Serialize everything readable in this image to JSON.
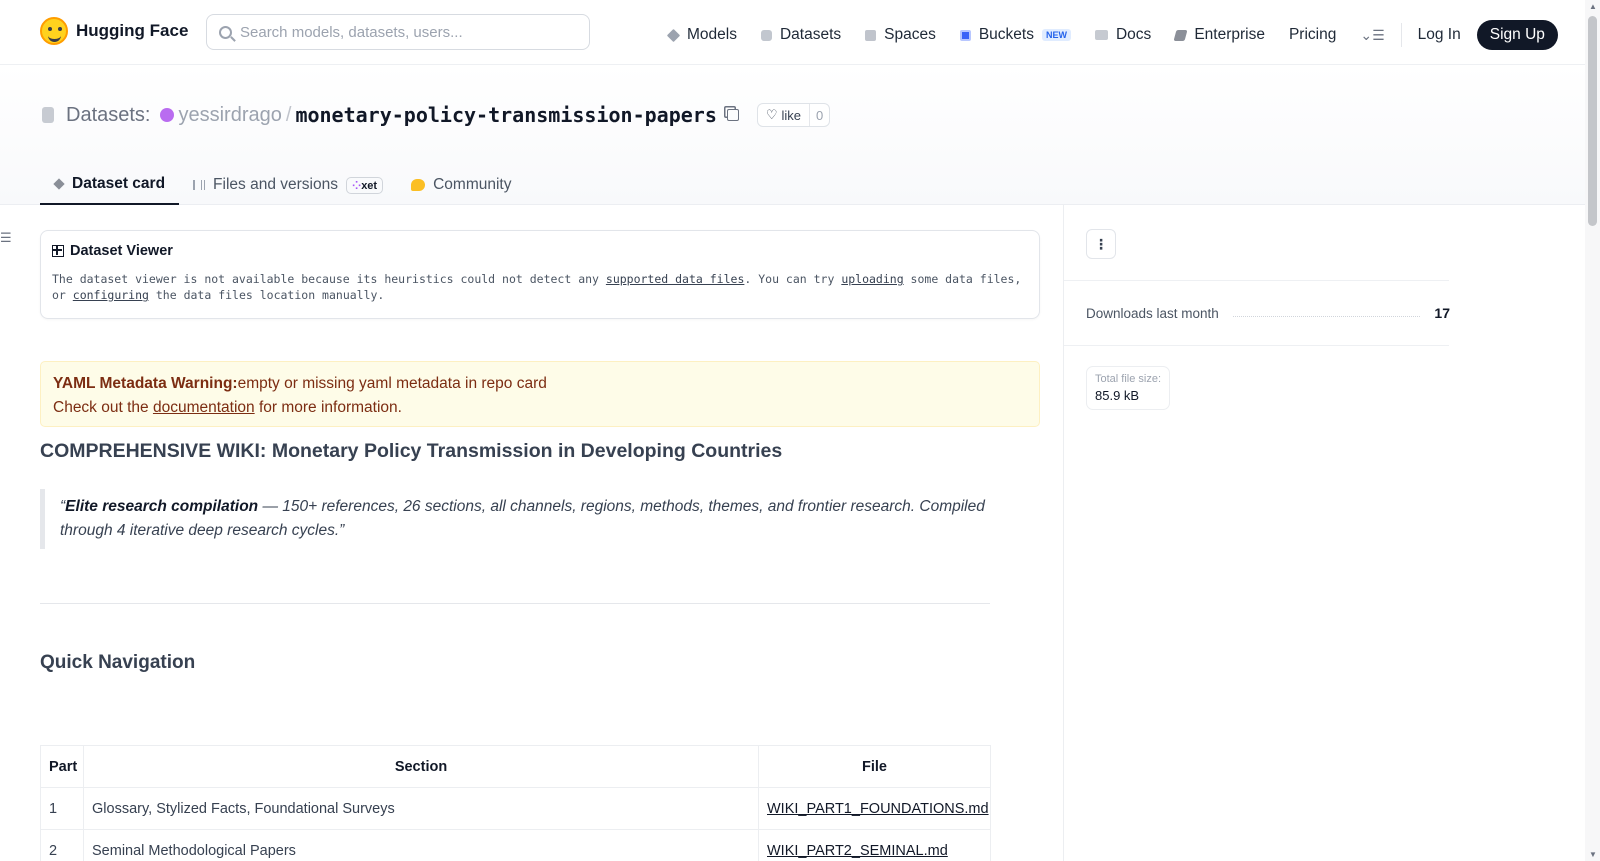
{
  "nav": {
    "brand": "Hugging Face",
    "search_placeholder": "Search models, datasets, users...",
    "links": [
      {
        "label": "Models",
        "icon": "cube-icon"
      },
      {
        "label": "Datasets",
        "icon": "database-icon"
      },
      {
        "label": "Spaces",
        "icon": "grid-icon"
      },
      {
        "label": "Buckets",
        "icon": "bucket-icon",
        "badge": "NEW"
      },
      {
        "label": "Docs",
        "icon": "book-icon"
      },
      {
        "label": "Enterprise",
        "icon": "enterprise-icon"
      },
      {
        "label": "Pricing"
      }
    ],
    "login": "Log In",
    "signup": "Sign Up"
  },
  "repo": {
    "type_label": "Datasets:",
    "owner": "yessirdrago",
    "separator": "/",
    "name": "monetary-policy-transmission-papers",
    "like_label": "like",
    "like_count": "0"
  },
  "tabs": [
    {
      "label": "Dataset card",
      "active": true
    },
    {
      "label": "Files and versions",
      "badge": "xet"
    },
    {
      "label": "Community"
    }
  ],
  "viewer": {
    "title": "Dataset Viewer",
    "text_1": "The dataset viewer is not available because its heuristics could not detect any ",
    "link_1": "supported data files",
    "text_2": ". You can try ",
    "link_2": "uploading",
    "text_3": " some data files, or ",
    "link_3": "configuring",
    "text_4": " the data files location manually."
  },
  "warning": {
    "bold": "YAML Metadata Warning:",
    "message": "empty or missing yaml metadata in repo card",
    "line2_pre": "Check out the ",
    "line2_link": "documentation",
    "line2_post": " for more information."
  },
  "card": {
    "title": "COMPREHENSIVE WIKI: Monetary Policy Transmission in Developing Countries",
    "quote_open": "“",
    "quote_bold": "Elite research compilation",
    "quote_rest": " — 150+ references, 26 sections, all channels, regions, methods, themes, and frontier research. Compiled through 4 iterative deep research cycles.”",
    "quick_nav": "Quick Navigation",
    "table_headers": [
      "Part",
      "Section",
      "File"
    ],
    "table_rows": [
      {
        "part": "1",
        "section": "Glossary, Stylized Facts, Foundational Surveys",
        "file": "WIKI_PART1_FOUNDATIONS.md"
      },
      {
        "part": "2",
        "section": "Seminal Methodological Papers",
        "file": "WIKI_PART2_SEMINAL.md"
      }
    ]
  },
  "sidebar": {
    "downloads_label": "Downloads last month",
    "downloads_value": "17",
    "file_size_label": "Total file size:",
    "file_size_value": "85.9 kB"
  },
  "colors": {
    "accent": "#111827",
    "warning_bg": "#fefce8",
    "warning_text": "#7c2d12",
    "avatar": "#b96cf0"
  }
}
